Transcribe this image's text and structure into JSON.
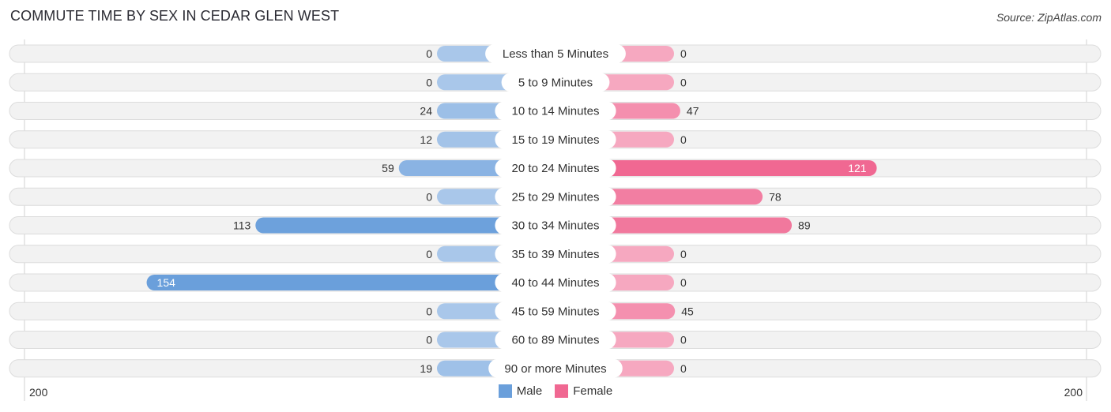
{
  "header": {
    "title": "COMMUTE TIME BY SEX IN CEDAR GLEN WEST",
    "source": "Source: ZipAtlas.com"
  },
  "colors": {
    "male_strong": "#6a9fdb",
    "male_light": "#a9c7ea",
    "female_strong": "#f06892",
    "female_light": "#f6a8c0",
    "row_bg": "#f2f2f2",
    "row_border": "#dcdcdc"
  },
  "chart_data": {
    "type": "bar",
    "orientation": "horizontal-diverging",
    "title": "COMMUTE TIME BY SEX IN CEDAR GLEN WEST",
    "categories": [
      "Less than 5 Minutes",
      "5 to 9 Minutes",
      "10 to 14 Minutes",
      "15 to 19 Minutes",
      "20 to 24 Minutes",
      "25 to 29 Minutes",
      "30 to 34 Minutes",
      "35 to 39 Minutes",
      "40 to 44 Minutes",
      "45 to 59 Minutes",
      "60 to 89 Minutes",
      "90 or more Minutes"
    ],
    "series": [
      {
        "name": "Male",
        "side": "left",
        "values": [
          0,
          0,
          24,
          12,
          59,
          0,
          113,
          0,
          154,
          0,
          0,
          19
        ]
      },
      {
        "name": "Female",
        "side": "right",
        "values": [
          0,
          0,
          47,
          0,
          121,
          78,
          89,
          0,
          0,
          45,
          0,
          0
        ]
      }
    ],
    "axis": {
      "min_label": "200",
      "max_label": "200",
      "range": [
        0,
        200
      ]
    },
    "legend": {
      "position": "bottom-center",
      "entries": [
        "Male",
        "Female"
      ]
    }
  }
}
